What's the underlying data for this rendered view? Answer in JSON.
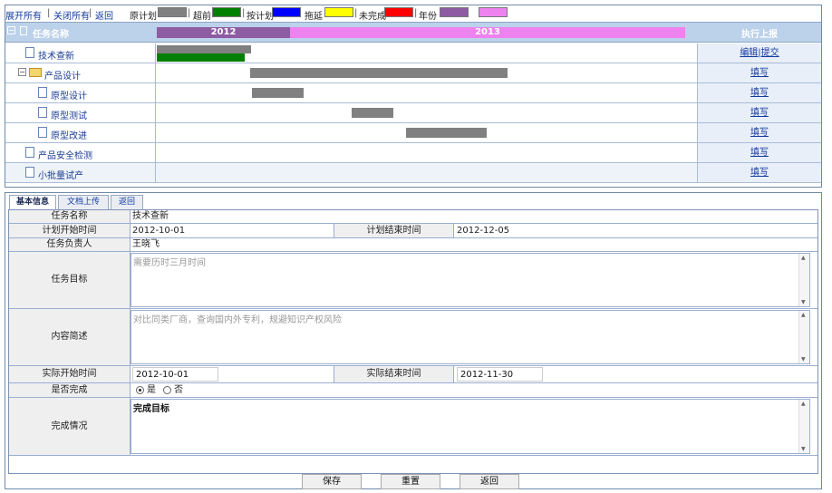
{
  "toolbar": {
    "expand_all": "展开所有",
    "collapse_all": "关闭所有",
    "back": "返回",
    "legend": [
      {
        "label": "原计划",
        "color": "#808080"
      },
      {
        "label": "超前",
        "color": "#008000"
      },
      {
        "label": "按计划",
        "color": "#0000ff"
      },
      {
        "label": "拖延",
        "color": "#ffff00"
      },
      {
        "label": "未完成",
        "color": "#ff0000"
      },
      {
        "label": "年份",
        "color": "#8e5ca3"
      },
      {
        "label": "",
        "color": "#ee82ee"
      }
    ]
  },
  "gantt": {
    "header_name": "任务名称",
    "header_action": "执行上报",
    "years": [
      "2012",
      "2013"
    ],
    "year_colors": [
      "#8e5ca3",
      "#ee82ee"
    ],
    "rows": [
      {
        "label": "技术查新",
        "action": "编辑|提交",
        "icon": "doc-icon"
      },
      {
        "label": "产品设计",
        "action": "填写",
        "icon": "folder-icon"
      },
      {
        "label": "原型设计",
        "action": "填写",
        "icon": "doc-icon"
      },
      {
        "label": "原型测试",
        "action": "填写",
        "icon": "doc-icon"
      },
      {
        "label": "原型改进",
        "action": "填写",
        "icon": "doc-icon"
      },
      {
        "label": "产品安全检测",
        "action": "填写",
        "icon": "doc-icon"
      },
      {
        "label": "小批量试产",
        "action": "填写",
        "icon": "doc-icon"
      }
    ]
  },
  "tabs": [
    "基本信息",
    "文档上传",
    "返回"
  ],
  "form": {
    "task_name_label": "任务名称",
    "task_name": "技术查新",
    "plan_start_label": "计划开始时间",
    "plan_start": "2012-10-01",
    "plan_end_label": "计划结束时间",
    "plan_end": "2012-12-05",
    "owner_label": "任务负责人",
    "owner": "王晓飞",
    "goal_label": "任务目标",
    "goal": "需要历时三月时间",
    "summary_label": "内容简述",
    "summary": "对比同类厂商，查询国内外专利，规避知识产权风险",
    "actual_start_label": "实际开始时间",
    "actual_start": "2012-10-01",
    "actual_end_label": "实际结束时间",
    "actual_end": "2012-11-30",
    "completed_label": "是否完成",
    "yes_label": "是",
    "no_label": "否",
    "completion_label": "完成情况",
    "completion": "完成目标"
  },
  "buttons": {
    "save": "保存",
    "reset": "重置",
    "back": "返回"
  }
}
